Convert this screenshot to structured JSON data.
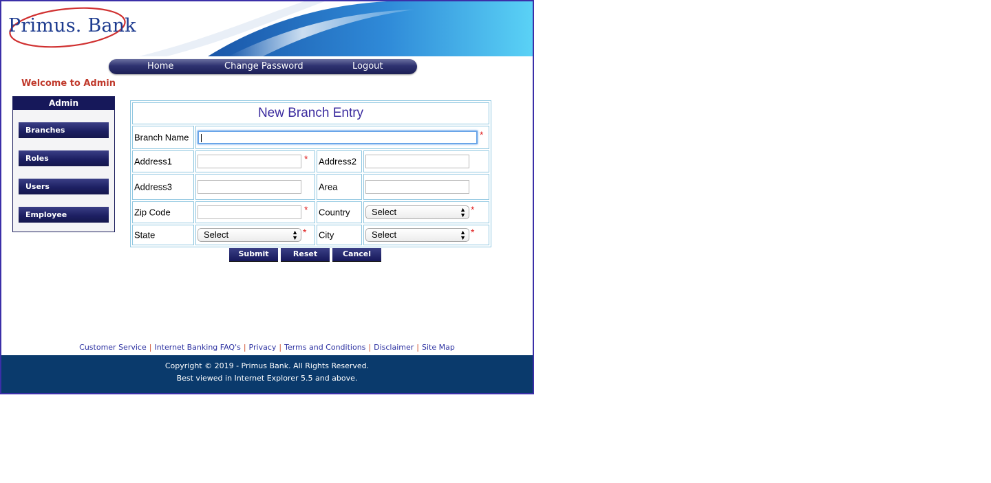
{
  "brand": {
    "name_part1": "Primus",
    "dot": ".",
    "name_part2": " Bank",
    "colors": {
      "brand_blue": "#1d3b8f",
      "swoosh_red": "#d03030",
      "header_cyan": "#3fb8ea"
    }
  },
  "nav": {
    "items": [
      {
        "label": "Home"
      },
      {
        "label": "Change Password"
      },
      {
        "label": "Logout"
      }
    ]
  },
  "welcome": "Welcome to Admin",
  "admin_panel": {
    "title": "Admin",
    "items": [
      {
        "label": "Branches"
      },
      {
        "label": "Roles"
      },
      {
        "label": "Users"
      },
      {
        "label": "Employee"
      }
    ]
  },
  "form": {
    "title": "New Branch Entry",
    "required_mark": "*",
    "fields": {
      "branch_name": {
        "label": "Branch Name",
        "value": ""
      },
      "address1": {
        "label": "Address1",
        "value": ""
      },
      "address2": {
        "label": "Address2",
        "value": ""
      },
      "address3": {
        "label": "Address3",
        "value": ""
      },
      "area": {
        "label": "Area",
        "value": ""
      },
      "zip_code": {
        "label": "Zip Code",
        "value": ""
      },
      "country": {
        "label": "Country",
        "selected": "Select"
      },
      "state": {
        "label": "State",
        "selected": "Select"
      },
      "city": {
        "label": "City",
        "selected": "Select"
      }
    },
    "buttons": {
      "submit": "Submit",
      "reset": "Reset",
      "cancel": "Cancel"
    }
  },
  "footer_links": [
    "Customer Service",
    "Internet Banking FAQ's",
    "Privacy",
    "Terms and Conditions",
    "Disclaimer",
    "Site Map"
  ],
  "footer": {
    "copyright": "Copyright © 2019 - Primus Bank. All Rights Reserved.",
    "browser_note": "Best viewed in Internet Explorer 5.5 and above."
  }
}
